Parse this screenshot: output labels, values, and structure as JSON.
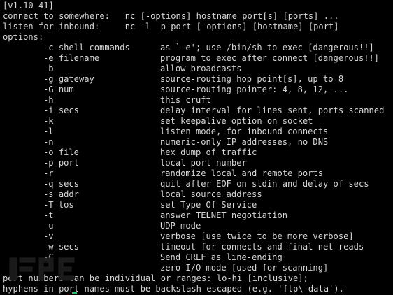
{
  "terminal": {
    "version": "[v1.10-41]",
    "usage_connect": "connect to somewhere:   nc [-options] hostname port[s] [ports] ...",
    "usage_listen": "listen for inbound:     nc -l -p port [-options] [hostname] [port]",
    "options_header": "options:",
    "options": [
      {
        "flag": "-c shell commands",
        "desc": "as `-e'; use /bin/sh to exec [dangerous!!]"
      },
      {
        "flag": "-e filename",
        "desc": "program to exec after connect [dangerous!!]"
      },
      {
        "flag": "-b",
        "desc": "allow broadcasts"
      },
      {
        "flag": "-g gateway",
        "desc": "source-routing hop point[s], up to 8"
      },
      {
        "flag": "-G num",
        "desc": "source-routing pointer: 4, 8, 12, ..."
      },
      {
        "flag": "-h",
        "desc": "this cruft"
      },
      {
        "flag": "-i secs",
        "desc": "delay interval for lines sent, ports scanned"
      },
      {
        "flag": "-k",
        "desc": "set keepalive option on socket"
      },
      {
        "flag": "-l",
        "desc": "listen mode, for inbound connects"
      },
      {
        "flag": "-n",
        "desc": "numeric-only IP addresses, no DNS"
      },
      {
        "flag": "-o file",
        "desc": "hex dump of traffic"
      },
      {
        "flag": "-p port",
        "desc": "local port number"
      },
      {
        "flag": "-r",
        "desc": "randomize local and remote ports"
      },
      {
        "flag": "-q secs",
        "desc": "quit after EOF on stdin and delay of secs"
      },
      {
        "flag": "-s addr",
        "desc": "local source address"
      },
      {
        "flag": "-T tos",
        "desc": "set Type Of Service"
      },
      {
        "flag": "-t",
        "desc": "answer TELNET negotiation"
      },
      {
        "flag": "-u",
        "desc": "UDP mode"
      },
      {
        "flag": "-v",
        "desc": "verbose [use twice to be more verbose]"
      },
      {
        "flag": "-w secs",
        "desc": "timeout for connects and final net reads"
      },
      {
        "flag": "-C",
        "desc": "Send CRLF as line-ending"
      },
      {
        "flag": "-z",
        "desc": "zero-I/O mode [used for scanning]"
      }
    ],
    "footer_1": "port numbers can be individual or ranges: lo-hi [inclusive];",
    "footer_2": "hyphens in port names must be backslash escaped (e.g. 'ftp\\-data')."
  },
  "colors": {
    "background": "#000000",
    "text": "#d6d6d6",
    "cursor": "#27c46d"
  },
  "icons": {
    "watermark": "freebuf-watermark-logo"
  }
}
